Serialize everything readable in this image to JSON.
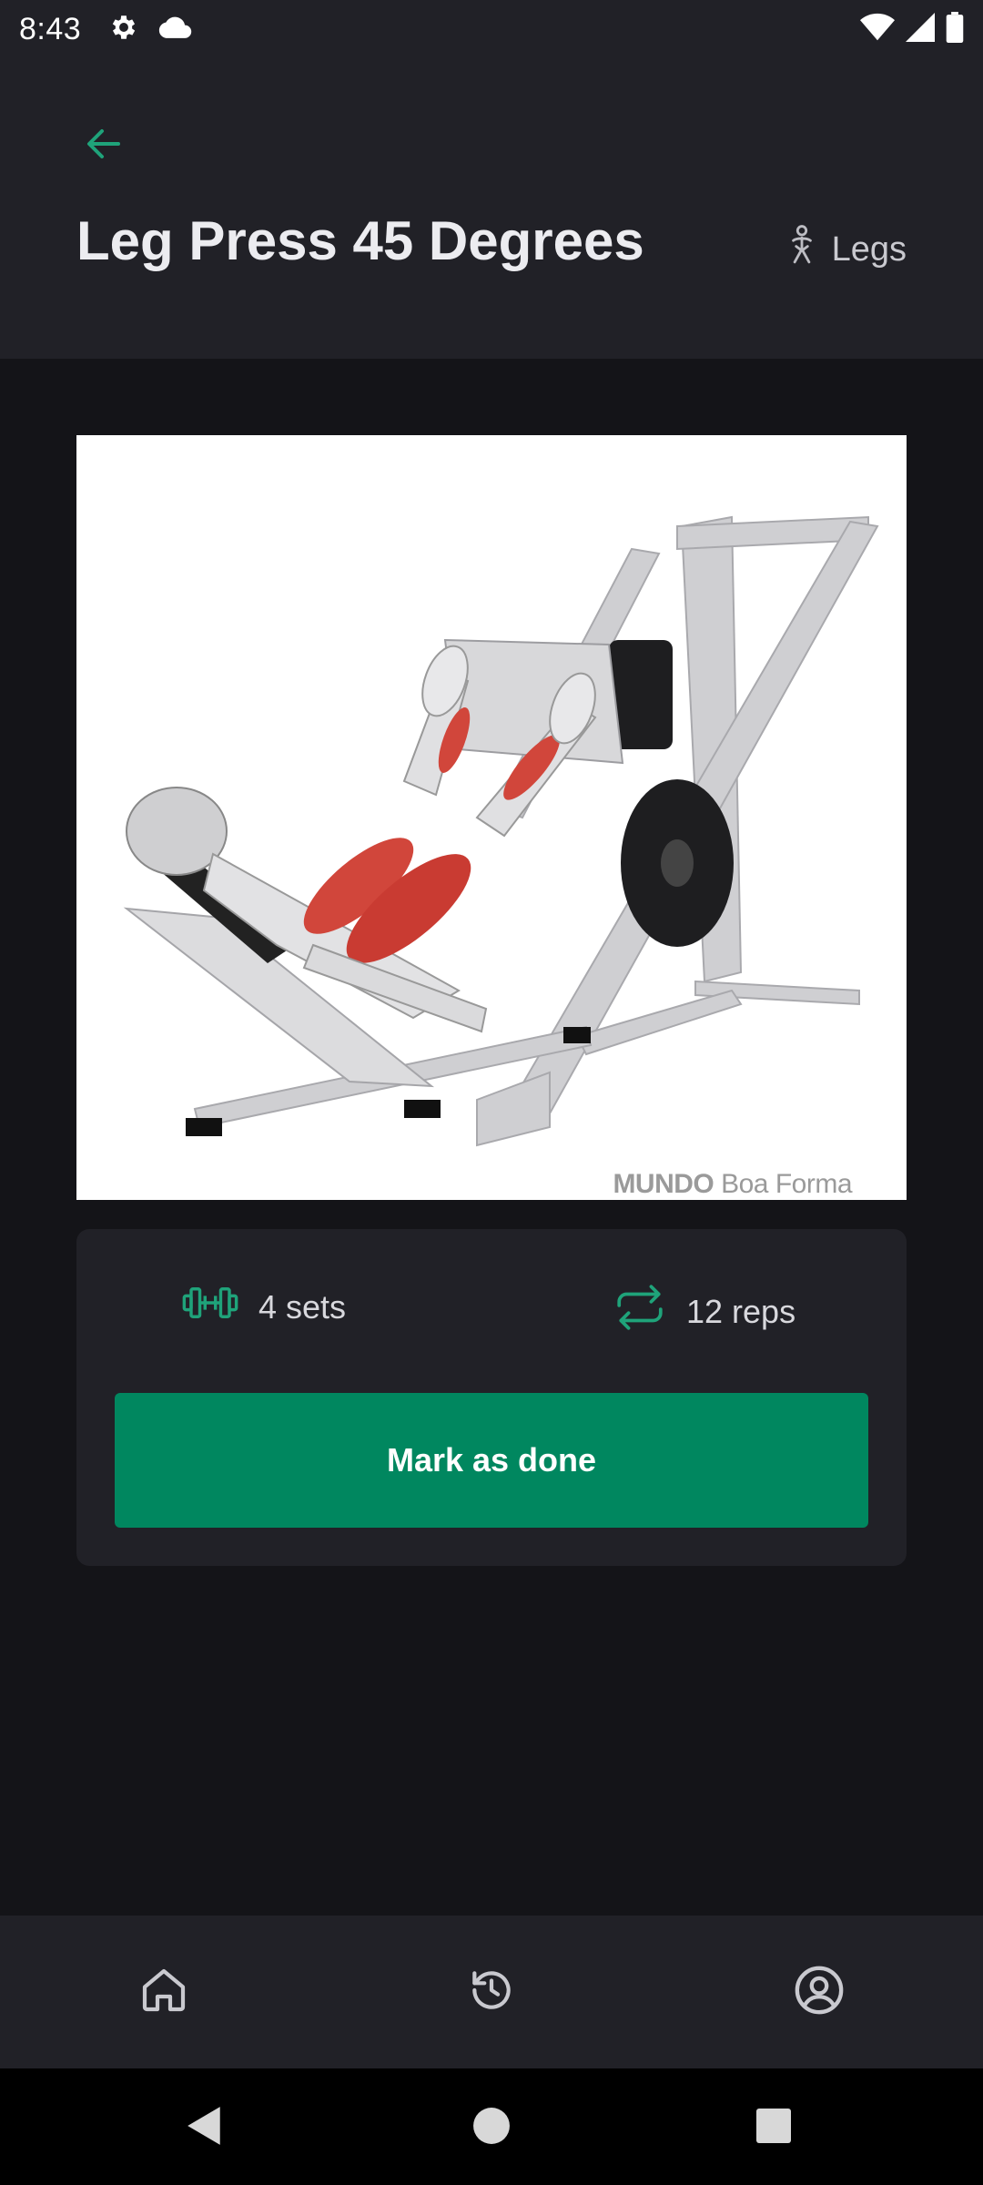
{
  "status_bar": {
    "time": "8:43",
    "icons": [
      "settings-icon",
      "cloud-icon",
      "wifi-icon",
      "signal-icon",
      "battery-icon"
    ]
  },
  "header": {
    "back_icon": "arrow-left-icon",
    "title": "Leg Press 45 Degrees",
    "muscle_icon": "body-figure-icon",
    "muscle_group": "Legs"
  },
  "exercise_image": {
    "description_icon": "leg-press-illustration",
    "watermark_bold": "MUNDO",
    "watermark_light": "Boa Forma"
  },
  "stats": {
    "sets_icon": "dumbbell-icon",
    "sets_label": "4 sets",
    "reps_icon": "repeat-icon",
    "reps_label": "12 reps"
  },
  "actions": {
    "mark_done_label": "Mark as done"
  },
  "bottom_nav": {
    "items": [
      {
        "icon": "home-icon"
      },
      {
        "icon": "history-icon"
      },
      {
        "icon": "profile-icon"
      }
    ]
  },
  "colors": {
    "accent": "#00875f",
    "accent_icon": "#1fa37a",
    "surface": "#212127",
    "background": "#141418"
  }
}
